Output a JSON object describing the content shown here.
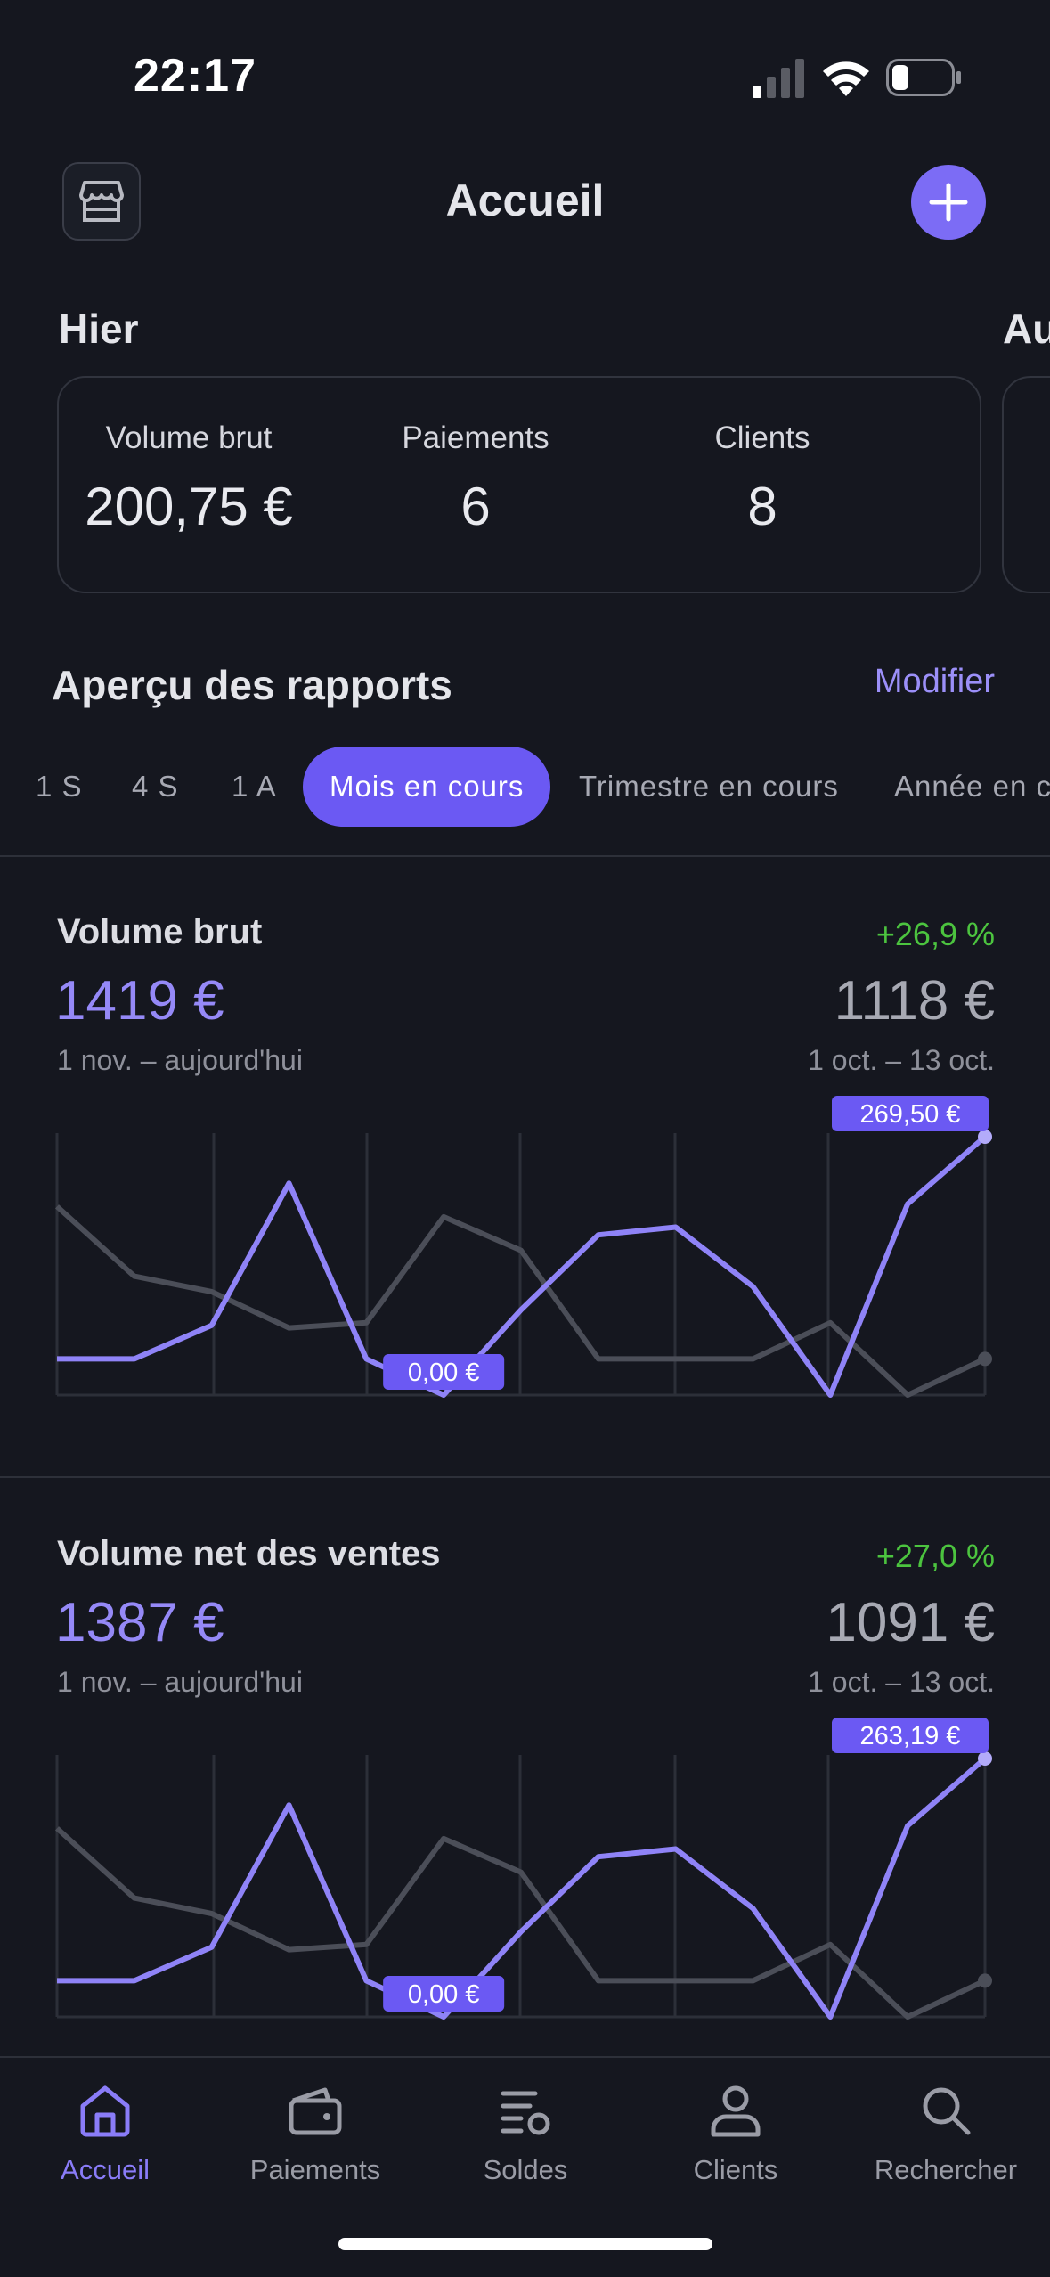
{
  "status_bar": {
    "time": "22:17"
  },
  "header": {
    "title": "Accueil",
    "store_icon": "store-icon",
    "add_icon": "plus-icon",
    "accent": "#7c6cf5"
  },
  "yesterday": {
    "title": "Hier",
    "next_title": "Au",
    "stats": [
      {
        "label": "Volume brut",
        "value": "200,75 €"
      },
      {
        "label": "Paiements",
        "value": "6"
      },
      {
        "label": "Clients",
        "value": "8"
      }
    ]
  },
  "reports": {
    "title": "Aperçu des rapports",
    "edit": "Modifier",
    "periods": [
      "1 S",
      "4 S",
      "1 A",
      "Mois en cours",
      "Trimestre en cours",
      "Année en c"
    ],
    "active_period": "Mois en cours"
  },
  "metrics": [
    {
      "title": "Volume brut",
      "change": "+26,9 %",
      "value": "1419 €",
      "compare_value": "1118 €",
      "dates": "1 nov. – aujourd'hui",
      "compare_dates": "1 oct. – 13 oct.",
      "chart_data": {
        "type": "line",
        "series": [
          {
            "values": [
              0.14,
              0.14,
              0.27,
              0.82,
              0.14,
              0.0,
              0.33,
              0.62,
              0.65,
              0.42,
              0.0,
              0.74,
              1.0
            ]
          },
          {
            "values": [
              0.73,
              0.46,
              0.4,
              0.26,
              0.28,
              0.69,
              0.56,
              0.14,
              0.14,
              0.14,
              0.28,
              0.0,
              0.14
            ]
          }
        ],
        "max_label": "269,50 €",
        "min_label": "0,00 €",
        "colors": {
          "current": "#8f83f7",
          "previous": "#4b4e58"
        }
      }
    },
    {
      "title": "Volume net des ventes",
      "change": "+27,0 %",
      "value": "1387 €",
      "compare_value": "1091 €",
      "dates": "1 nov. – aujourd'hui",
      "compare_dates": "1 oct. – 13 oct.",
      "chart_data": {
        "type": "line",
        "series": [
          {
            "values": [
              0.14,
              0.14,
              0.27,
              0.82,
              0.14,
              0.0,
              0.33,
              0.62,
              0.65,
              0.42,
              0.0,
              0.74,
              1.0
            ]
          },
          {
            "values": [
              0.73,
              0.46,
              0.4,
              0.26,
              0.28,
              0.69,
              0.56,
              0.14,
              0.14,
              0.14,
              0.28,
              0.0,
              0.14
            ]
          }
        ],
        "max_label": "263,19 €",
        "min_label": "0,00 €",
        "colors": {
          "current": "#8f83f7",
          "previous": "#4b4e58"
        }
      }
    }
  ],
  "tabbar": {
    "items": [
      {
        "label": "Accueil",
        "icon": "home-icon",
        "active": true
      },
      {
        "label": "Paiements",
        "icon": "wallet-icon",
        "active": false
      },
      {
        "label": "Soldes",
        "icon": "balances-icon",
        "active": false
      },
      {
        "label": "Clients",
        "icon": "person-icon",
        "active": false
      },
      {
        "label": "Rechercher",
        "icon": "search-icon",
        "active": false
      }
    ]
  }
}
